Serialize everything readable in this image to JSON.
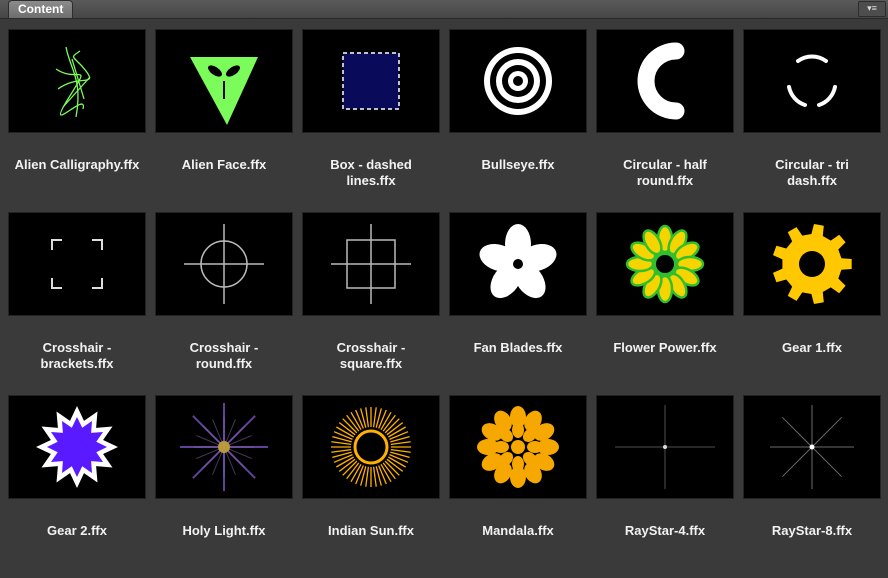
{
  "panel": {
    "tab_label": "Content",
    "menu_icon": "panel-menu-icon"
  },
  "items": [
    {
      "label": "Alien Calligraphy.ffx",
      "icon": "alien-calligraphy-icon"
    },
    {
      "label": "Alien Face.ffx",
      "icon": "alien-face-icon"
    },
    {
      "label": "Box - dashed\nlines.ffx",
      "icon": "box-dashed-icon"
    },
    {
      "label": "Bullseye.ffx",
      "icon": "bullseye-icon"
    },
    {
      "label": "Circular - half\nround.ffx",
      "icon": "circular-half-round-icon"
    },
    {
      "label": "Circular - tri\ndash.ffx",
      "icon": "circular-tri-dash-icon"
    },
    {
      "label": "Crosshair -\nbrackets.ffx",
      "icon": "crosshair-brackets-icon"
    },
    {
      "label": "Crosshair -\nround.ffx",
      "icon": "crosshair-round-icon"
    },
    {
      "label": "Crosshair -\nsquare.ffx",
      "icon": "crosshair-square-icon"
    },
    {
      "label": "Fan Blades.ffx",
      "icon": "fan-blades-icon"
    },
    {
      "label": "Flower Power.ffx",
      "icon": "flower-power-icon"
    },
    {
      "label": "Gear 1.ffx",
      "icon": "gear-1-icon"
    },
    {
      "label": "Gear 2.ffx",
      "icon": "gear-2-icon"
    },
    {
      "label": "Holy Light.ffx",
      "icon": "holy-light-icon"
    },
    {
      "label": "Indian Sun.ffx",
      "icon": "indian-sun-icon"
    },
    {
      "label": "Mandala.ffx",
      "icon": "mandala-icon"
    },
    {
      "label": "RayStar-4.ffx",
      "icon": "raystar-4-icon"
    },
    {
      "label": "RayStar-8.ffx",
      "icon": "raystar-8-icon"
    }
  ],
  "colors": {
    "panel_bg": "#3a3a3a",
    "thumb_bg": "#000000",
    "alien_green": "#7cfc5a",
    "box_fill": "#0a0a5a",
    "flower_yellow": "#f5d400",
    "flower_green": "#2fbf2f",
    "gear_yellow": "#ffc800",
    "gear2_purple": "#5a1aff",
    "sun_orange": "#ffb000",
    "mandala_orange": "#f7a800"
  }
}
